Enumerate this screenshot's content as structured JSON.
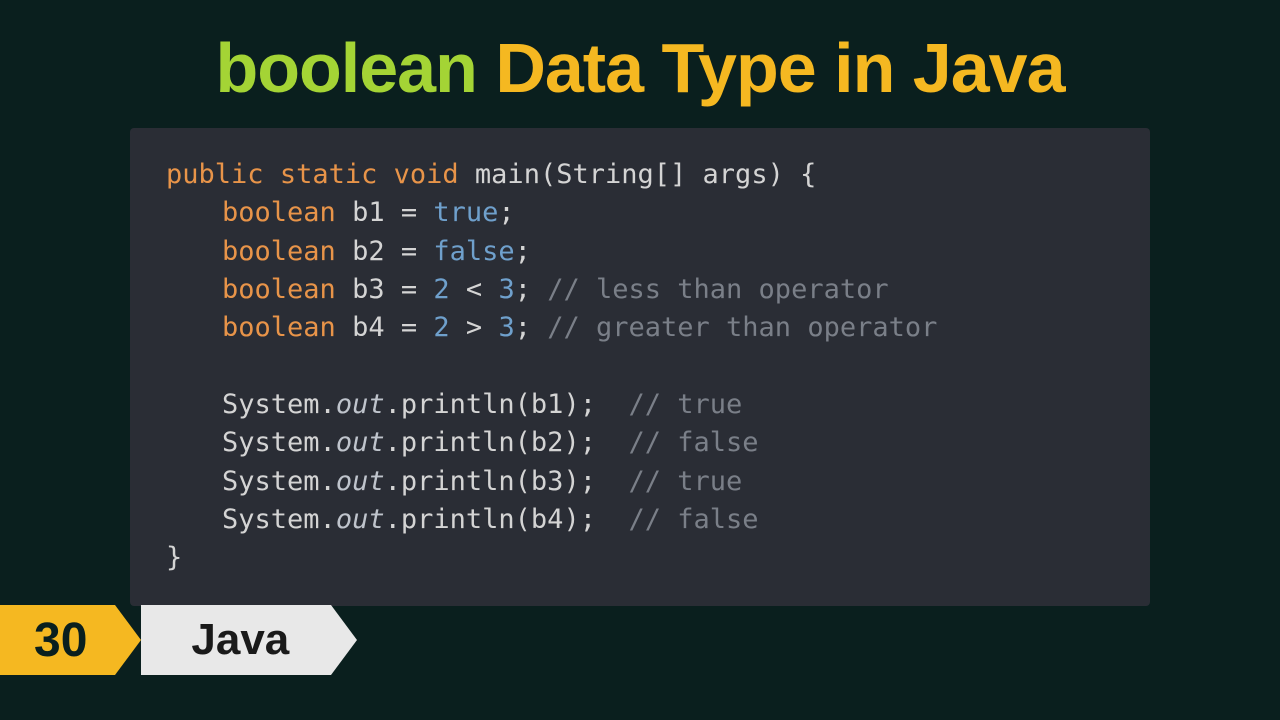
{
  "title": {
    "word1": "boolean",
    "rest": "Data Type in Java"
  },
  "code": {
    "line1": {
      "kw1": "public",
      "kw2": "static",
      "kw3": "void",
      "fn": "main",
      "argtype": "String",
      "argname": "args"
    },
    "line2": {
      "type": "boolean",
      "var": "b1",
      "val": "true"
    },
    "line3": {
      "type": "boolean",
      "var": "b2",
      "val": "false"
    },
    "line4": {
      "type": "boolean",
      "var": "b3",
      "n1": "2",
      "op": "<",
      "n2": "3",
      "comment": "// less than operator"
    },
    "line5": {
      "type": "boolean",
      "var": "b4",
      "n1": "2",
      "op": ">",
      "n2": "3",
      "comment": "// greater than operator"
    },
    "line6": {
      "obj": "System",
      "out": "out",
      "fn": "println",
      "arg": "b1",
      "comment": "// true"
    },
    "line7": {
      "obj": "System",
      "out": "out",
      "fn": "println",
      "arg": "b2",
      "comment": "// false"
    },
    "line8": {
      "obj": "System",
      "out": "out",
      "fn": "println",
      "arg": "b3",
      "comment": "// true"
    },
    "line9": {
      "obj": "System",
      "out": "out",
      "fn": "println",
      "arg": "b4",
      "comment": "// false"
    }
  },
  "badge": {
    "number": "30",
    "label": "Java"
  }
}
